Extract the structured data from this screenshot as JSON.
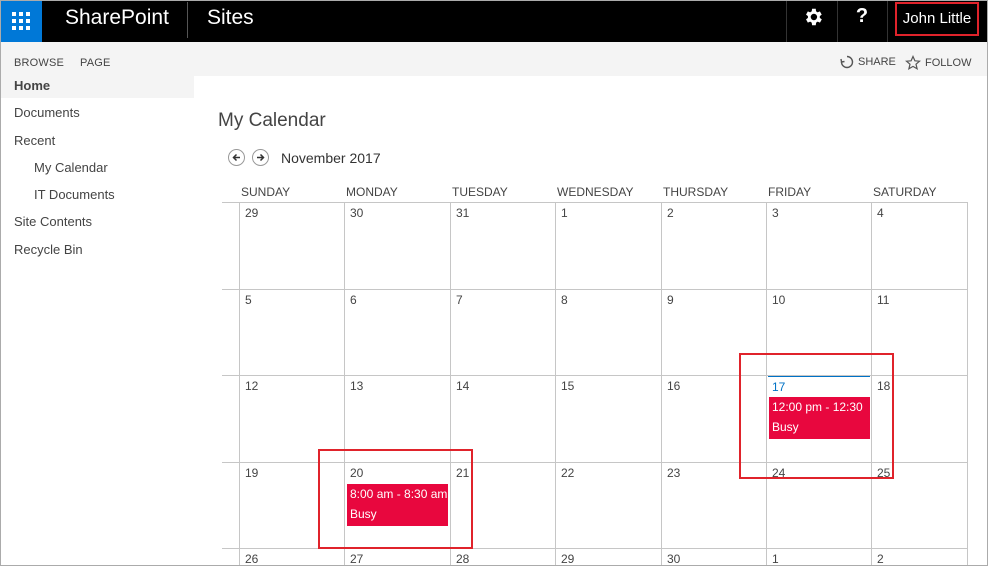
{
  "suitebar": {
    "brand": "SharePoint",
    "section": "Sites",
    "settings_icon": "gear-icon",
    "help_label": "?",
    "user_name": "John Little"
  },
  "ribbon": {
    "browse": "BROWSE",
    "page": "PAGE",
    "share": "SHARE",
    "follow": "FOLLOW"
  },
  "leftnav": {
    "home": "Home",
    "documents": "Documents",
    "recent": "Recent",
    "my_calendar": "My Calendar",
    "it_documents": "IT Documents",
    "site_contents": "Site Contents",
    "recycle_bin": "Recycle Bin"
  },
  "calendar": {
    "title": "My Calendar",
    "month": "November 2017",
    "weekdays": [
      "SUNDAY",
      "MONDAY",
      "TUESDAY",
      "WEDNESDAY",
      "THURSDAY",
      "FRIDAY",
      "SATURDAY"
    ],
    "weeks": [
      [
        "29",
        "30",
        "31",
        "1",
        "2",
        "3",
        "4"
      ],
      [
        "5",
        "6",
        "7",
        "8",
        "9",
        "10",
        "11"
      ],
      [
        "12",
        "13",
        "14",
        "15",
        "16",
        "17",
        "18"
      ],
      [
        "19",
        "20",
        "21",
        "22",
        "23",
        "24",
        "25"
      ],
      [
        "26",
        "27",
        "28",
        "29",
        "30",
        "1",
        "2"
      ]
    ],
    "today": "17",
    "events": [
      {
        "day": "17",
        "time": "12:00 pm - 12:30",
        "status": "Busy"
      },
      {
        "day": "20",
        "time": "8:00 am - 8:30 am",
        "status": "Busy"
      }
    ],
    "event_color": "#e8073e",
    "today_color": "#0072c6"
  },
  "colors": {
    "suitebar_bg": "#000000",
    "waffle_bg": "#0078d7",
    "highlight": "#e0232b"
  }
}
